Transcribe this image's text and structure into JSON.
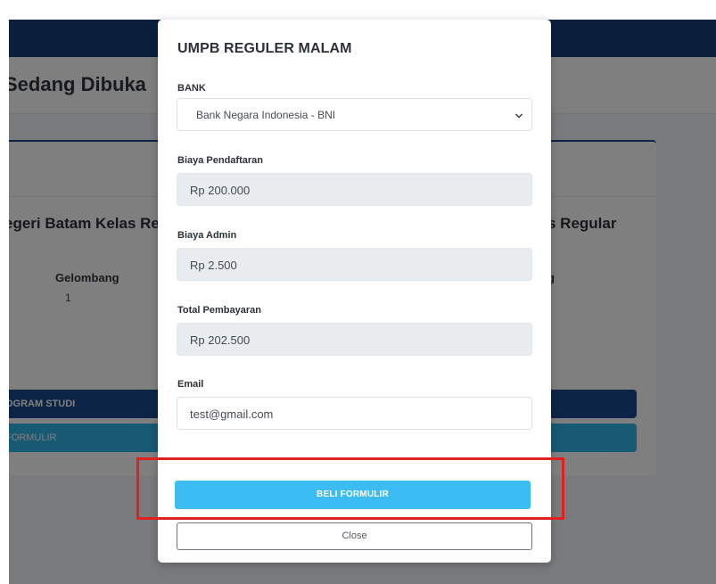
{
  "background": {
    "page_heading": "Sedang Dibuka",
    "card_left_title": "egeri Batam Kelas Reg",
    "card_right_title": "s Regular",
    "meta_label": "Gelombang",
    "meta_value": "1",
    "meta_label_right": "g",
    "program_button_label": "OGRAM STUDI",
    "form_button_label": "FORMULIR"
  },
  "modal": {
    "title": "UMPB REGULER MALAM",
    "bank": {
      "label": "BANK",
      "selected": "Bank Negara Indonesia - BNI"
    },
    "registration_fee": {
      "label": "Biaya Pendaftaran",
      "value": "Rp 200.000"
    },
    "admin_fee": {
      "label": "Biaya Admin",
      "value": "Rp 2.500"
    },
    "total_payment": {
      "label": "Total Pembayaran",
      "value": "Rp 202.500"
    },
    "email": {
      "label": "Email",
      "value": "test@gmail.com"
    },
    "buy_button_label": "BELI FORMULIR",
    "close_button_label": "Close"
  },
  "colors": {
    "navbar": "#173f7a",
    "primary_dark": "#184a8c",
    "primary_light": "#3bbdf4",
    "highlight": "#e1201f"
  },
  "icons": {
    "select_dropdown": "chevron-down-icon"
  }
}
